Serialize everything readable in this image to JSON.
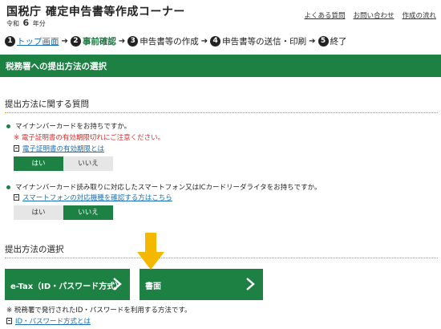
{
  "header": {
    "title": "国税庁 確定申告書等作成コーナー",
    "era": "令和",
    "year": "6",
    "year_suffix": "年分",
    "links": [
      "よくある質問",
      "お問い合わせ",
      "作成の流れ"
    ]
  },
  "steps": [
    {
      "num": "1",
      "label": "トップ画面"
    },
    {
      "num": "2",
      "label": "事前確認"
    },
    {
      "num": "3",
      "label": "申告書等の作成"
    },
    {
      "num": "4",
      "label": "申告書等の送信・印刷"
    },
    {
      "num": "5",
      "label": "終了"
    }
  ],
  "banner": "税務署への提出方法の選択",
  "questions_section": {
    "title": "提出方法に関する質問",
    "q1": {
      "text": "マイナンバーカードをお持ちですか。",
      "warning": "※ 電子証明書の有効期限切れにご注意ください。",
      "link": "電子証明書の有効期限とは",
      "yes": "はい",
      "no": "いいえ",
      "selected": "はい"
    },
    "q2": {
      "text": "マイナンバーカード読み取りに対応したスマートフォン又はICカードリーダライタをお持ちですか。",
      "link": "スマートフォンの対応機種を確認する方はこちら",
      "yes": "はい",
      "no": "いいえ",
      "selected": "いいえ"
    }
  },
  "method_section": {
    "title": "提出方法の選択",
    "etax_button": "e-Tax（ID・パスワード方式）",
    "paper_button": "書面",
    "note": "※ 税務署で発行されたID・パスワードを利用する方法です。",
    "link": "ID・パスワード方式とは"
  },
  "colors": {
    "brand_green": "#1d8144",
    "arrow_yellow": "#f5b800",
    "link_blue": "#1a6fb5",
    "warning_red": "#d03030"
  }
}
